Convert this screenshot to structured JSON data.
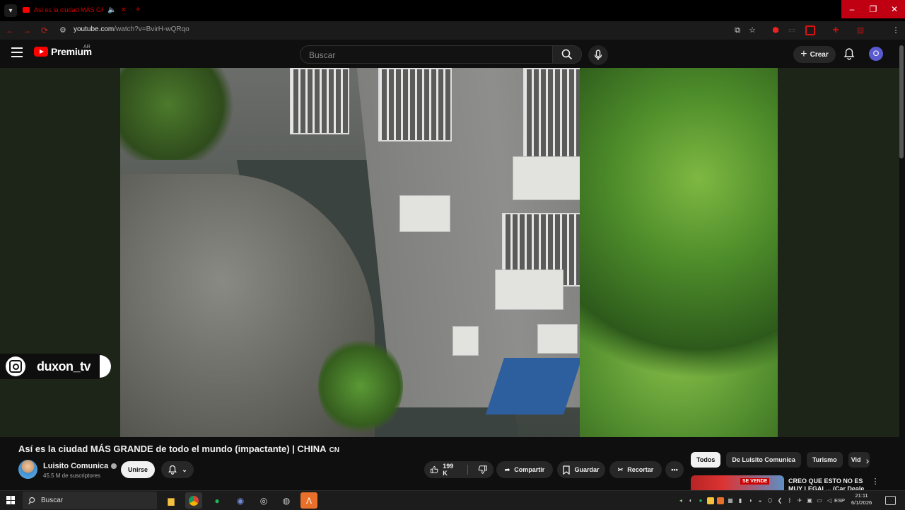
{
  "browser": {
    "tab_title": "Así es la ciudad MÁS GRAN...",
    "url_host": "youtube.com",
    "url_path": "/watch?v=BvirH-wQRqo",
    "profile_initial": "O",
    "window_buttons": [
      "–",
      "❐",
      "✕"
    ]
  },
  "header": {
    "brand": "Premium",
    "region": "AR",
    "search_placeholder": "Buscar",
    "create_label": "Crear",
    "avatar_initial": "O"
  },
  "player": {
    "overlay_handle": "duxon_tv"
  },
  "video": {
    "title": "Así es la ciudad MÁS GRANDE de todo el mundo (impactante) | CHINA",
    "title_flag": "CN",
    "channel_name": "Luisito Comunica",
    "subscribers": "45.5 M de suscriptores",
    "join_label": "Unirse",
    "likes": "199 K",
    "share_label": "Compartir",
    "save_label": "Guardar",
    "clip_label": "Recortar"
  },
  "recommendations": {
    "chips": [
      "Todos",
      "De Luisito Comunica",
      "Turismo",
      "Vid"
    ],
    "first_title": "CREO QUE ESTO NO ES MUY LEGAL... (Car Deale",
    "thumb_text": "SE VENDE"
  },
  "taskbar": {
    "search_label": "Buscar",
    "language": "ESP",
    "time": "21:11",
    "date": "6/1/2026"
  },
  "colors": {
    "brand_red": "#ff0000",
    "background": "#0f0f0f",
    "chip_bg": "#272727"
  }
}
